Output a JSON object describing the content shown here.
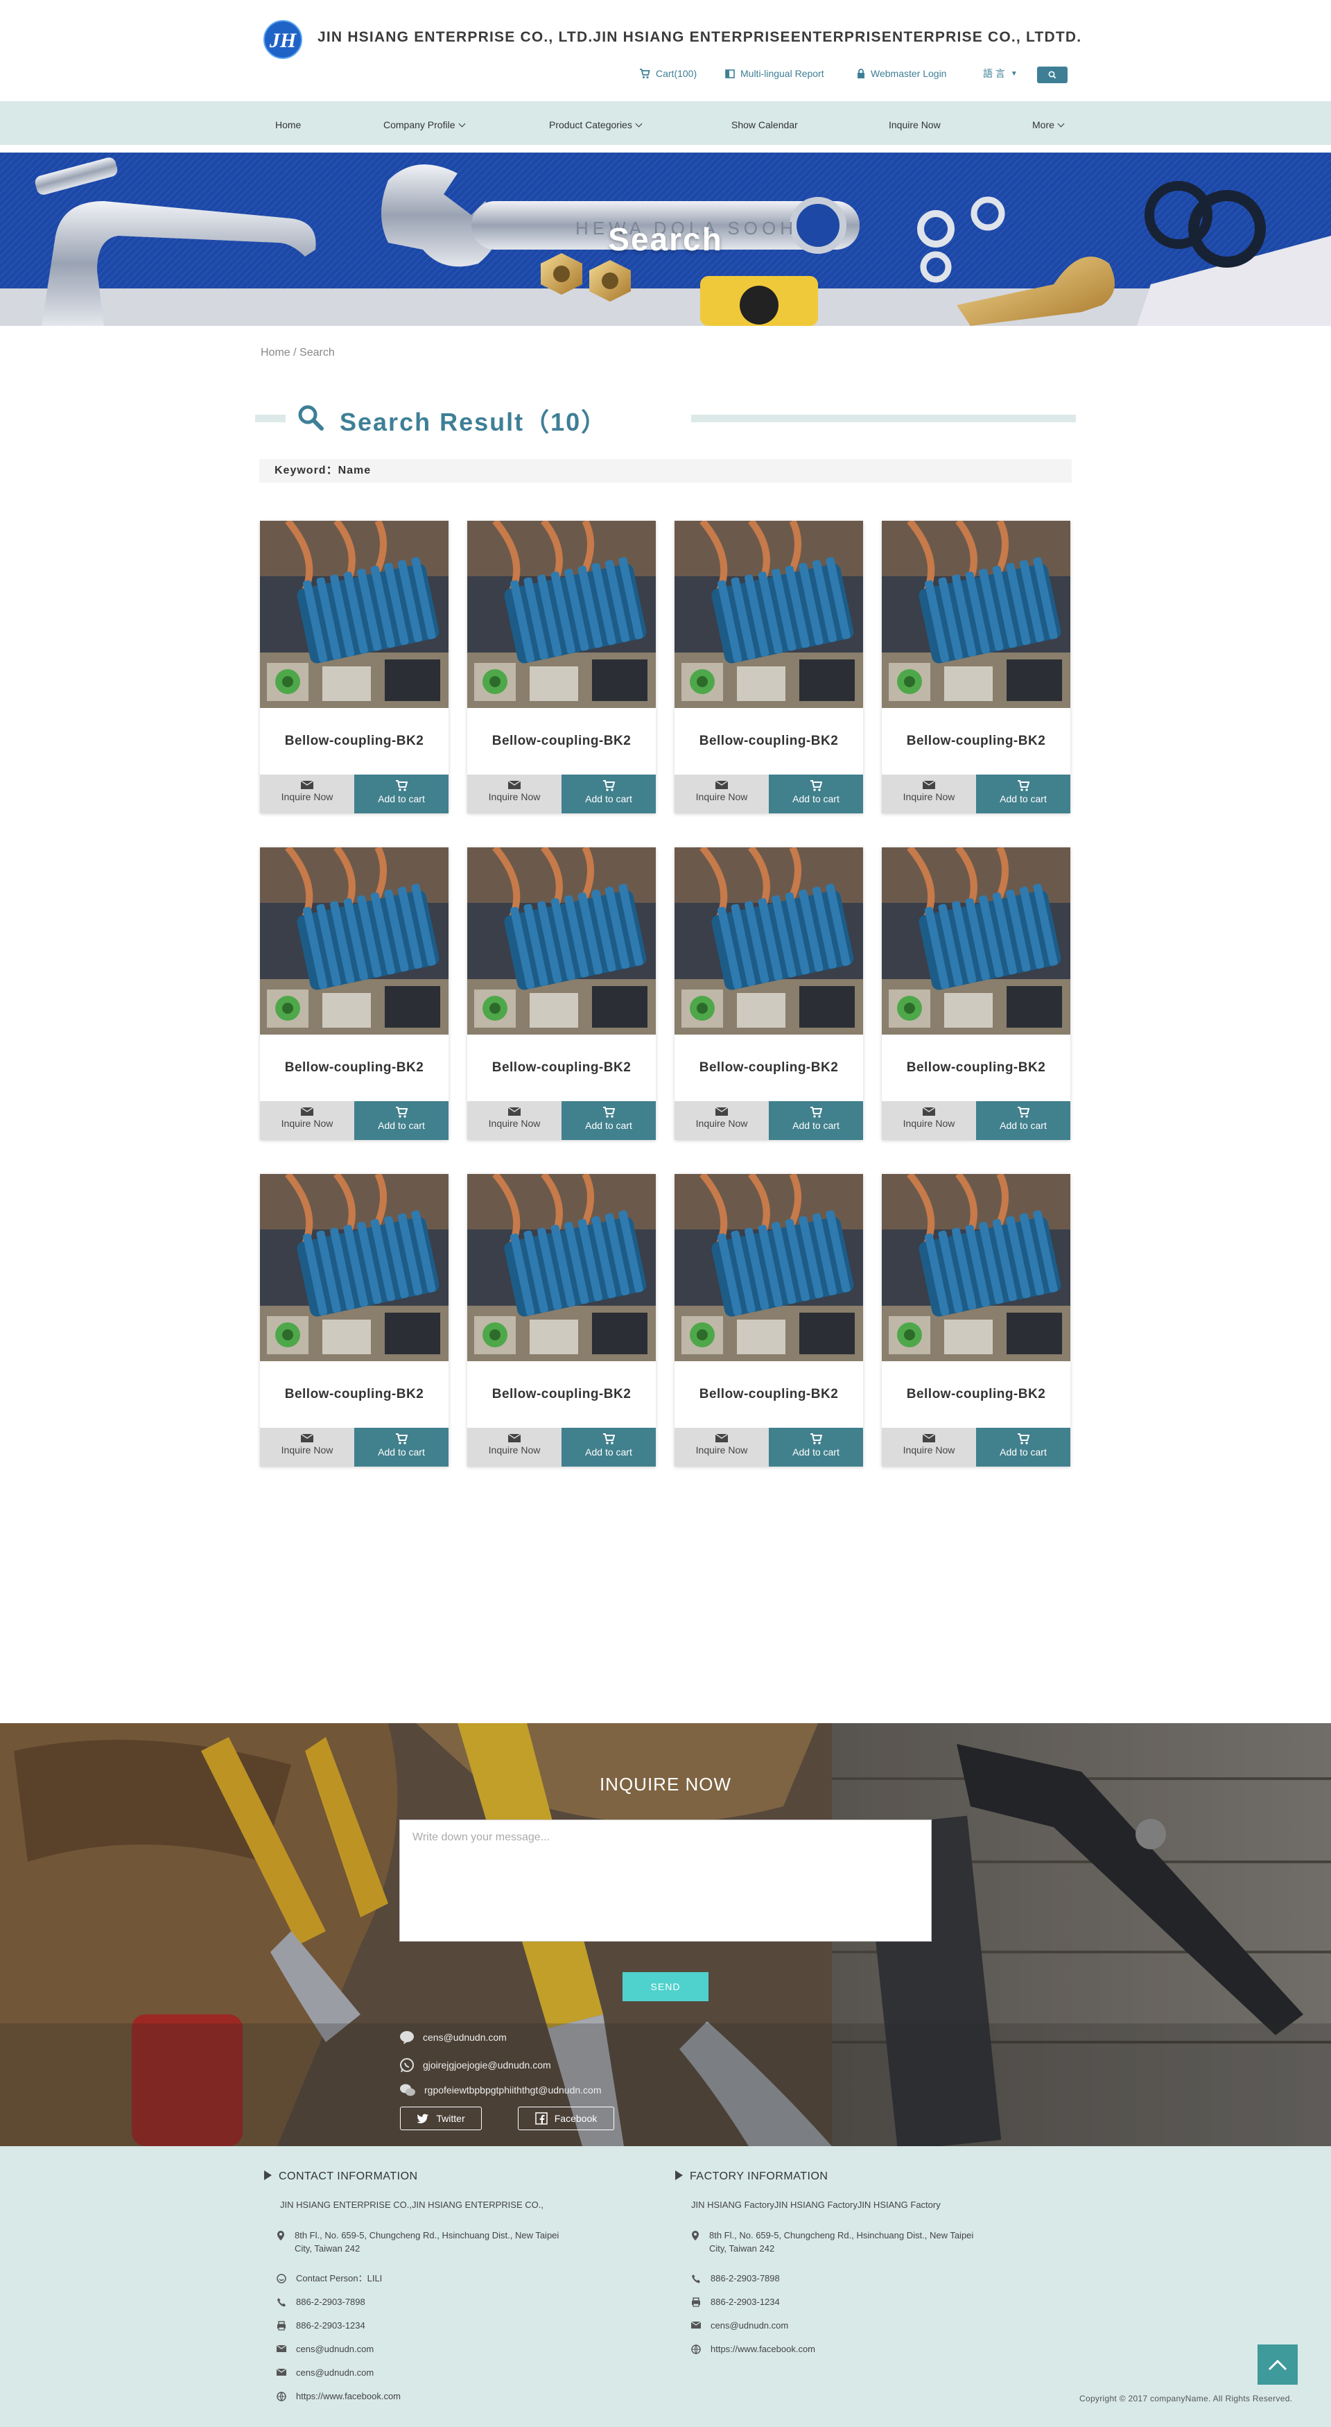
{
  "header": {
    "logo_text": "JH",
    "site_title": "JIN HSIANG ENTERPRISE CO., LTD.JIN HSIANG ENTERPRISEENTERPRISENTERPRISE CO., LTDTD.",
    "cart_label": "Cart(100)",
    "report_label": "Multi-lingual Report",
    "login_label": "Webmaster Login",
    "language_label": "語 言",
    "search_icon": "search-icon"
  },
  "nav": {
    "items": [
      {
        "label": "Home"
      },
      {
        "label": "Company Profile"
      },
      {
        "label": "Product Categories"
      },
      {
        "label": "Show Calendar"
      },
      {
        "label": "Inquire Now"
      },
      {
        "label": "More"
      }
    ]
  },
  "banner": {
    "title": "Search"
  },
  "breadcrumb": {
    "home": "Home",
    "separator": "/",
    "current": "Search"
  },
  "results": {
    "title": "Search Result（10）",
    "keyword_label": "Keyword：Name"
  },
  "products": [
    {
      "name": "Bellow-coupling-BK2",
      "inquire_label": "Inquire Now",
      "cart_label": "Add to cart"
    },
    {
      "name": "Bellow-coupling-BK2",
      "inquire_label": "Inquire Now",
      "cart_label": "Add to cart"
    },
    {
      "name": "Bellow-coupling-BK2",
      "inquire_label": "Inquire Now",
      "cart_label": "Add to cart"
    },
    {
      "name": "Bellow-coupling-BK2",
      "inquire_label": "Inquire Now",
      "cart_label": "Add to cart"
    },
    {
      "name": "Bellow-coupling-BK2",
      "inquire_label": "Inquire Now",
      "cart_label": "Add to cart"
    },
    {
      "name": "Bellow-coupling-BK2",
      "inquire_label": "Inquire Now",
      "cart_label": "Add to cart"
    },
    {
      "name": "Bellow-coupling-BK2",
      "inquire_label": "Inquire Now",
      "cart_label": "Add to cart"
    },
    {
      "name": "Bellow-coupling-BK2",
      "inquire_label": "Inquire Now",
      "cart_label": "Add to cart"
    },
    {
      "name": "Bellow-coupling-BK2",
      "inquire_label": "Inquire Now",
      "cart_label": "Add to cart"
    },
    {
      "name": "Bellow-coupling-BK2",
      "inquire_label": "Inquire Now",
      "cart_label": "Add to cart"
    },
    {
      "name": "Bellow-coupling-BK2",
      "inquire_label": "Inquire Now",
      "cart_label": "Add to cart"
    },
    {
      "name": "Bellow-coupling-BK2",
      "inquire_label": "Inquire Now",
      "cart_label": "Add to cart"
    }
  ],
  "inquiry": {
    "title": "INQUIRE NOW",
    "placeholder": "Write down your message...",
    "send_label": "SEND",
    "line_id": "cens@udnudn.com",
    "whatsapp": "gjoirejgjoejogie@udnudn.com",
    "wechat": "rgpofeiewtbpbpgtphiiththgt@udnudn.com",
    "twitter_label": "Twitter",
    "facebook_label": "Facebook"
  },
  "footer": {
    "contact_heading": "CONTACT INFORMATION",
    "company_name": "JIN HSIANG ENTERPRISE CO.,JIN HSIANG ENTERPRISE CO.,",
    "address_line1": "8th Fl., No. 659-5, Chungcheng Rd., Hsinchuang Dist., New Taipei",
    "address_line2": "City, Taiwan 242",
    "contact_person": "Contact Person：LILI",
    "phone": "886-2-2903-7898",
    "fax": "886-2-2903-1234",
    "email1": "cens@udnudn.com",
    "email2": "cens@udnudn.com",
    "website": "https://www.facebook.com",
    "factory_heading": "FACTORY INFORMATION",
    "factory_name": "JIN HSIANG FactoryJIN HSIANG FactoryJIN HSIANG Factory",
    "f_address_line1": "8th Fl., No. 659-5, Chungcheng Rd., Hsinchuang Dist., New Taipei",
    "f_address_line2": "City, Taiwan 242",
    "f_phone": "886-2-2903-7898",
    "f_fax": "886-2-2903-1234",
    "f_email": "cens@udnudn.com",
    "f_website": "https://www.facebook.com",
    "copyright": "Copyright © 2017 companyName. All Rights Reserved."
  },
  "colors": {
    "accent": "#3e7f96",
    "cart_button": "#41808d",
    "send_button": "#4fd1cd",
    "footer_bg": "#d8e9e7",
    "nav_bg": "#d8e9e7"
  }
}
